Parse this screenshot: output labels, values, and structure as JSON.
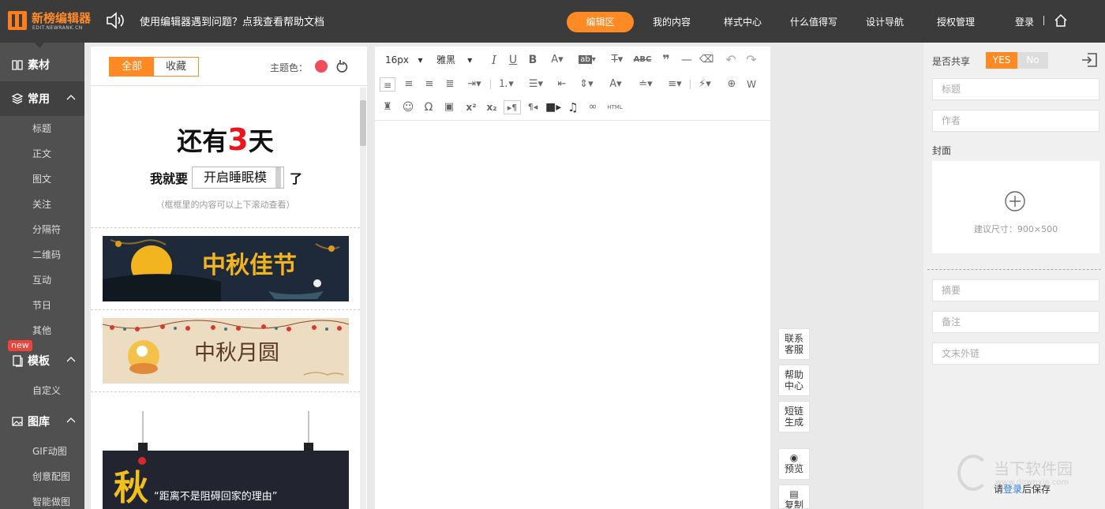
{
  "app": {
    "logo_name": "新榜编辑器",
    "logo_sub": "EDIT.NEWRANK.CN",
    "notice": "使用编辑器遇到问题？点我查看帮助文档",
    "accent_color": "#ff8a24"
  },
  "nav": {
    "items": [
      "编辑区",
      "我的内容",
      "样式中心",
      "什么值得写",
      "设计导航",
      "授权管理"
    ],
    "active": "编辑区",
    "login": "登录"
  },
  "sidebar": {
    "material": "素材",
    "common": "常用",
    "common_items": [
      "标题",
      "正文",
      "图文",
      "关注",
      "分隔符",
      "二维码",
      "互动",
      "节日",
      "其他"
    ],
    "new_badge": "new",
    "template": "模板",
    "template_items": [
      "自定义"
    ],
    "gallery": "图库",
    "gallery_items": [
      "GIF动图",
      "创意配图",
      "智能做图"
    ]
  },
  "materials": {
    "tab_all": "全部",
    "tab_fav": "收藏",
    "theme_label": "主题色：",
    "theme_color": "#ef4d5a",
    "countdown_pre": "还有",
    "countdown_num": "3",
    "countdown_post": "天",
    "sleep_pre": "我就要",
    "sleep_box": "开启睡眠模",
    "sleep_post": "了",
    "hint": "（框框里的内容可以上下滚动查看）",
    "banner1_title": "中秋佳节",
    "banner2_title": "中秋月圆",
    "banner3_char": "秋",
    "banner3_quote": "“距离不是阻碍回家的理由”"
  },
  "toolbar": {
    "font_size": "16px",
    "font_family": "雅黑",
    "html_label": "HTML"
  },
  "side_actions": {
    "contact": [
      "联系",
      "客服"
    ],
    "help": [
      "帮助",
      "中心"
    ],
    "shortlink": [
      "短链",
      "生成"
    ],
    "preview": "预览",
    "copy": "复制"
  },
  "right_panel": {
    "share_label": "是否共享",
    "yes": "YES",
    "no": "No",
    "title_placeholder": "标题",
    "author_placeholder": "作者",
    "cover_label": "封面",
    "cover_hint": "建议尺寸：900×500",
    "summary_placeholder": "摘要",
    "note_placeholder": "备注",
    "link_placeholder": "文末外链",
    "save_pre": "请",
    "save_link": "登录",
    "save_post": "后保存"
  },
  "watermark": {
    "text": "当下软件园",
    "url": "www.downxia.com"
  }
}
